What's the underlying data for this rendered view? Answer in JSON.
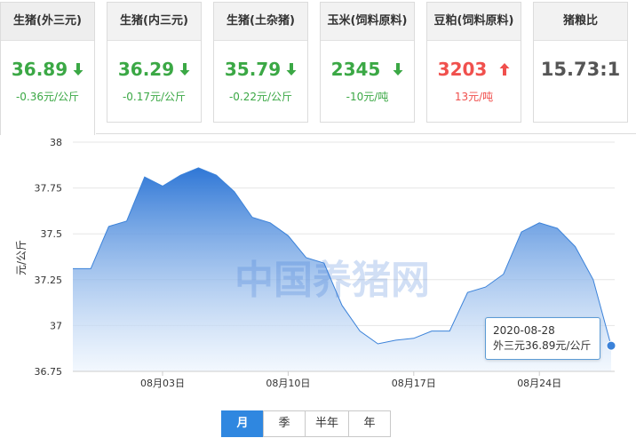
{
  "cards": [
    {
      "title": "生猪(外三元)",
      "value": "36.89",
      "change": "-0.36元/公斤",
      "trend": "down"
    },
    {
      "title": "生猪(内三元)",
      "value": "36.29",
      "change": "-0.17元/公斤",
      "trend": "down"
    },
    {
      "title": "生猪(土杂猪)",
      "value": "35.79",
      "change": "-0.22元/公斤",
      "trend": "down"
    },
    {
      "title": "玉米(饲料原料)",
      "value": "2345",
      "change": "-10元/吨",
      "trend": "down"
    },
    {
      "title": "豆粕(饲料原料)",
      "value": "3203",
      "change": "13元/吨",
      "trend": "up"
    },
    {
      "title": "猪粮比",
      "value": "15.73:1",
      "change": "",
      "trend": "none"
    }
  ],
  "colors": {
    "down": "#3ba845",
    "up": "#f0504d",
    "line": "#3b82d9",
    "fill_top": "#2f77d6",
    "fill_bottom": "#eaf3fd",
    "active_tab": "#2f87e0"
  },
  "chart_data": {
    "type": "area",
    "ylabel": "元/公斤",
    "ylim": [
      36.75,
      38
    ],
    "yticks": [
      "38",
      "37.75",
      "37.5",
      "37.25",
      "37",
      "36.75"
    ],
    "xtick_labels": [
      "08月03日",
      "08月10日",
      "08月17日",
      "08月24日"
    ],
    "grid": true,
    "watermark": "中国养猪网",
    "series": [
      {
        "values": [
          37.31,
          37.31,
          37.54,
          37.57,
          37.81,
          37.76,
          37.82,
          37.86,
          37.82,
          37.73,
          37.59,
          37.56,
          37.49,
          37.37,
          37.34,
          37.11,
          36.97,
          36.9,
          36.92,
          36.93,
          36.97,
          36.97,
          37.18,
          37.21,
          37.28,
          37.51,
          37.56,
          37.53,
          37.43,
          37.25,
          36.89
        ]
      }
    ],
    "x_dates": [
      "07-29",
      "07-30",
      "07-31",
      "08-01",
      "08-02",
      "08-03",
      "08-04",
      "08-05",
      "08-06",
      "08-07",
      "08-08",
      "08-09",
      "08-10",
      "08-11",
      "08-12",
      "08-13",
      "08-14",
      "08-15",
      "08-16",
      "08-17",
      "08-18",
      "08-19",
      "08-20",
      "08-21",
      "08-22",
      "08-23",
      "08-24",
      "08-25",
      "08-26",
      "08-27",
      "08-28"
    ]
  },
  "tooltip": {
    "date": "2020-08-28",
    "text": "外三元36.89元/公斤"
  },
  "tabs": [
    "月",
    "季",
    "半年",
    "年"
  ],
  "active_tab": "月"
}
